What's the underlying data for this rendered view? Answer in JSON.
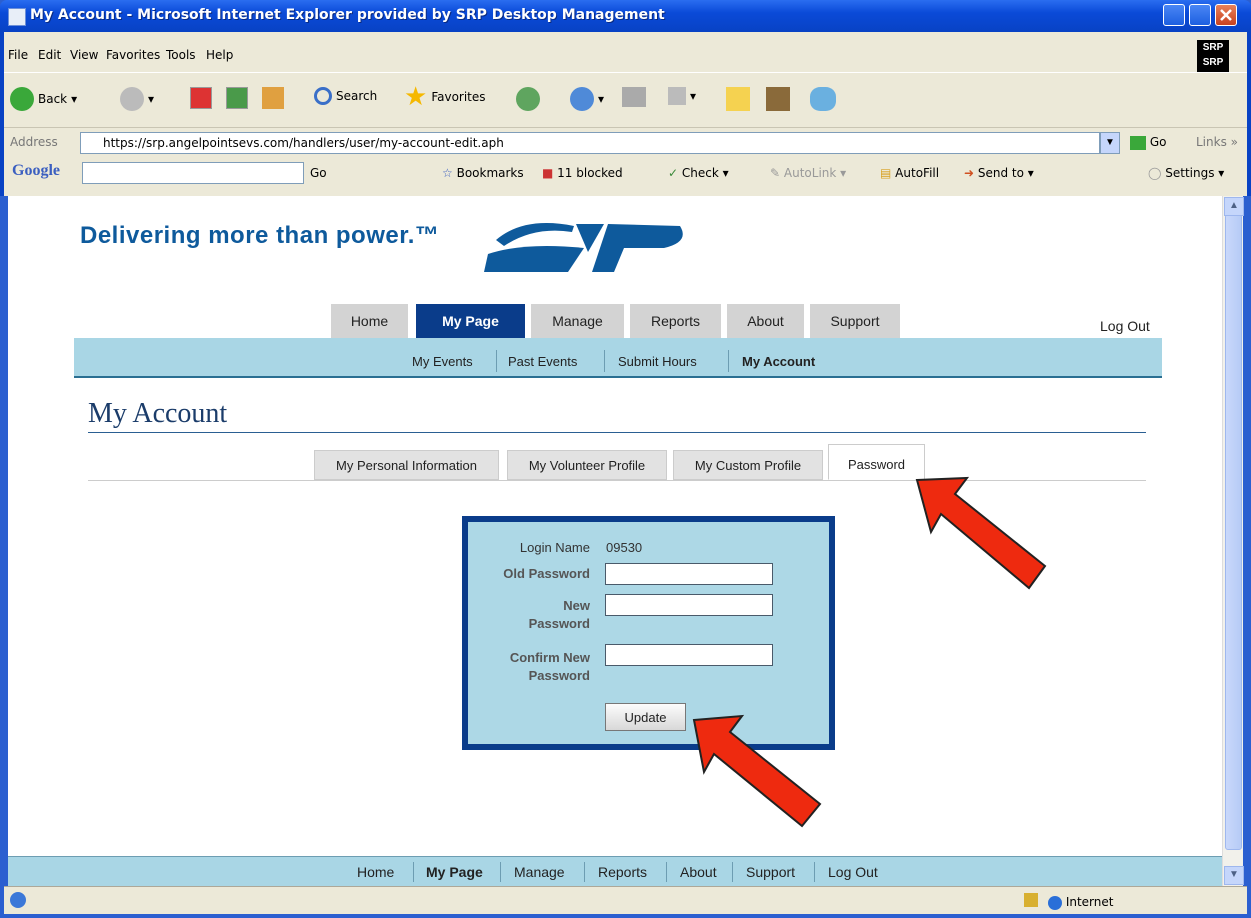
{
  "window": {
    "title": "My Account - Microsoft Internet Explorer provided by SRP Desktop Management"
  },
  "menubar": [
    "File",
    "Edit",
    "View",
    "Favorites",
    "Tools",
    "Help"
  ],
  "toolbar": {
    "back": "Back",
    "search": "Search",
    "favorites": "Favorites"
  },
  "address": {
    "label": "Address",
    "url": "https://srp.angelpointsevs.com/handlers/user/my-account-edit.aph",
    "go": "Go",
    "links": "Links"
  },
  "googlebar": {
    "logo": "Google",
    "go": "Go",
    "bookmarks": "Bookmarks",
    "blocked": "11 blocked",
    "check": "Check",
    "autolink": "AutoLink",
    "autofill": "AutoFill",
    "sendto": "Send to",
    "settings": "Settings"
  },
  "site": {
    "tagline": "Delivering more than power.™",
    "nav": [
      "Home",
      "My Page",
      "Manage",
      "Reports",
      "About",
      "Support"
    ],
    "active_nav": "My Page",
    "logout": "Log Out",
    "subnav": [
      "My Events",
      "Past Events",
      "Submit Hours",
      "My Account"
    ],
    "heading": "My Account",
    "profile_tabs": [
      "My Personal Information",
      "My Volunteer Profile",
      "My Custom Profile",
      "Password"
    ],
    "active_tab": "Password"
  },
  "form": {
    "login_label": "Login Name",
    "login_value": "09530",
    "old_password": "Old Password",
    "new_password_1": "New",
    "new_password_2": "Password",
    "confirm_1": "Confirm New",
    "confirm_2": "Password",
    "update": "Update"
  },
  "footer": [
    "Home",
    "My Page",
    "Manage",
    "Reports",
    "About",
    "Support",
    "Log Out"
  ],
  "status": {
    "zone": "Internet"
  }
}
